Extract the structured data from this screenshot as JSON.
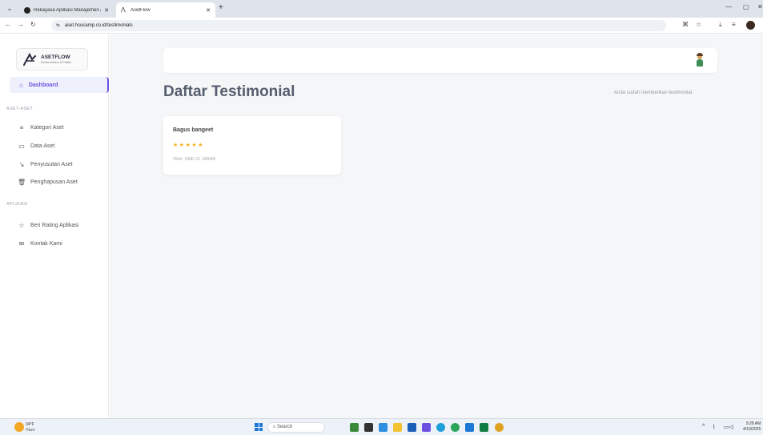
{
  "browser": {
    "tabs": [
      {
        "label": "Rekayasa Aplikasi Manajemen A",
        "active": false
      },
      {
        "label": "AsetFlow",
        "active": true
      }
    ],
    "url": "aset.hsucamp.co.id/testimonials"
  },
  "sidebar": {
    "logo_title": "ASETFLOW",
    "logo_subtitle": "Kenda Modern & Praktis",
    "dashboard_label": "Dashboard",
    "section_aset": "ASET-ASET",
    "aset_items": [
      {
        "label": "Kategori Aset",
        "icon": "list-icon"
      },
      {
        "label": "Data Aset",
        "icon": "folder-icon"
      },
      {
        "label": "Penyusutan Aset",
        "icon": "trend-icon"
      },
      {
        "label": "Penghapusan Aset",
        "icon": "trash-icon"
      }
    ],
    "section_aplikasi": "APLIKASI",
    "aplikasi_items": [
      {
        "label": "Beri Rating Aplikasi",
        "icon": "star-icon"
      },
      {
        "label": "Kontak Kami",
        "icon": "mail-icon"
      }
    ]
  },
  "main": {
    "title": "Daftar Testimonial",
    "notice": "Anda sudah memberikan testimonial.",
    "testimonials": [
      {
        "title": "Bagus bangeet",
        "stars": "★★★★★",
        "rating": 5,
        "author": "Oleh: SMK 01 JABAR"
      }
    ]
  },
  "taskbar": {
    "weather_temp": "34°F",
    "weather_desc": "Haze",
    "search_placeholder": "Search",
    "time": "9:28 AM",
    "date": "4/10/2025"
  },
  "colors": {
    "accent": "#6b4fe0",
    "star": "#f2b01e",
    "background": "#f5f6f8"
  }
}
